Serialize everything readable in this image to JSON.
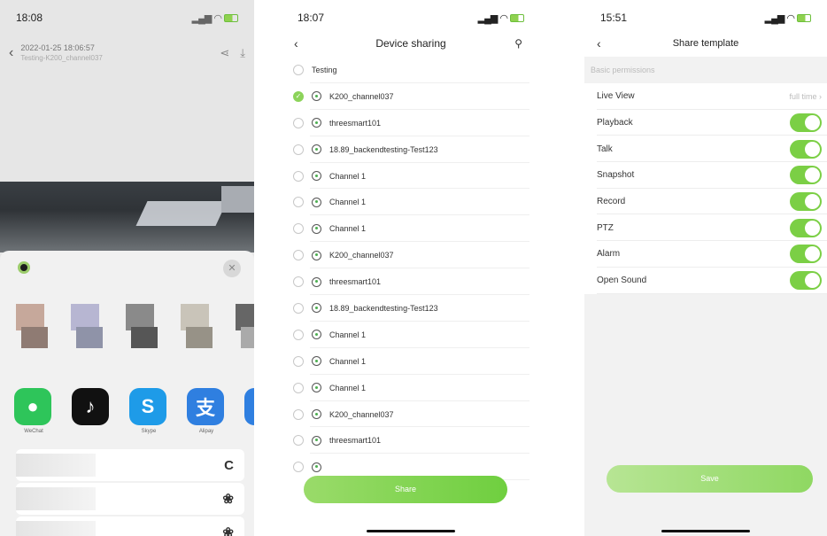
{
  "screen1": {
    "status_time": "18:08",
    "header_date": "2022-01-25 18:06:57",
    "header_sub": "Testing-K200_channel037",
    "apps": [
      {
        "label": "WeChat",
        "icon": "wechat-icon",
        "color": "#2ec55a",
        "glyph": "●"
      },
      {
        "label": "",
        "icon": "tiktok-icon",
        "color": "#111111",
        "glyph": "♪"
      },
      {
        "label": "Skype",
        "icon": "skype-icon",
        "color": "#1e9be8",
        "glyph": "S"
      },
      {
        "label": "Alipay",
        "icon": "alipay-icon",
        "color": "#2f7fe0",
        "glyph": "支"
      },
      {
        "label": "",
        "icon": "app-icon",
        "color": "#2f7fe0",
        "glyph": ""
      }
    ],
    "rows": [
      {
        "icon": "copy-icon",
        "glyph": "C"
      },
      {
        "icon": "share-circle-icon",
        "glyph": "❀"
      },
      {
        "icon": "share-circle-icon",
        "glyph": "❀"
      }
    ]
  },
  "screen2": {
    "status_time": "18:07",
    "title": "Device sharing",
    "share_label": "Share",
    "devices": [
      {
        "name": "Testing",
        "checked": false,
        "camera": false
      },
      {
        "name": "K200_channel037",
        "checked": true,
        "camera": true
      },
      {
        "name": "threesmart101",
        "checked": false,
        "camera": true
      },
      {
        "name": "18.89_backendtesting-Test123",
        "checked": false,
        "camera": true
      },
      {
        "name": "Channel 1",
        "checked": false,
        "camera": true
      },
      {
        "name": "Channel 1",
        "checked": false,
        "camera": true
      },
      {
        "name": "Channel 1",
        "checked": false,
        "camera": true
      },
      {
        "name": "K200_channel037",
        "checked": false,
        "camera": true
      },
      {
        "name": "threesmart101",
        "checked": false,
        "camera": true
      },
      {
        "name": "18.89_backendtesting-Test123",
        "checked": false,
        "camera": true
      },
      {
        "name": "Channel 1",
        "checked": false,
        "camera": true
      },
      {
        "name": "Channel 1",
        "checked": false,
        "camera": true
      },
      {
        "name": "Channel 1",
        "checked": false,
        "camera": true
      },
      {
        "name": "K200_channel037",
        "checked": false,
        "camera": true
      },
      {
        "name": "threesmart101",
        "checked": false,
        "camera": true
      },
      {
        "name": "",
        "checked": false,
        "camera": true
      }
    ]
  },
  "screen3": {
    "status_time": "15:51",
    "title": "Share template",
    "section": "Basic permissions",
    "live_view": {
      "label": "Live View",
      "value": "full time"
    },
    "permissions": [
      {
        "label": "Playback",
        "enabled": true
      },
      {
        "label": "Talk",
        "enabled": true
      },
      {
        "label": "Snapshot",
        "enabled": true
      },
      {
        "label": "Record",
        "enabled": true
      },
      {
        "label": "PTZ",
        "enabled": true
      },
      {
        "label": "Alarm",
        "enabled": true
      },
      {
        "label": "Open Sound",
        "enabled": true
      }
    ],
    "save_label": "Save"
  },
  "colors": {
    "accent": "#7bcf45"
  }
}
